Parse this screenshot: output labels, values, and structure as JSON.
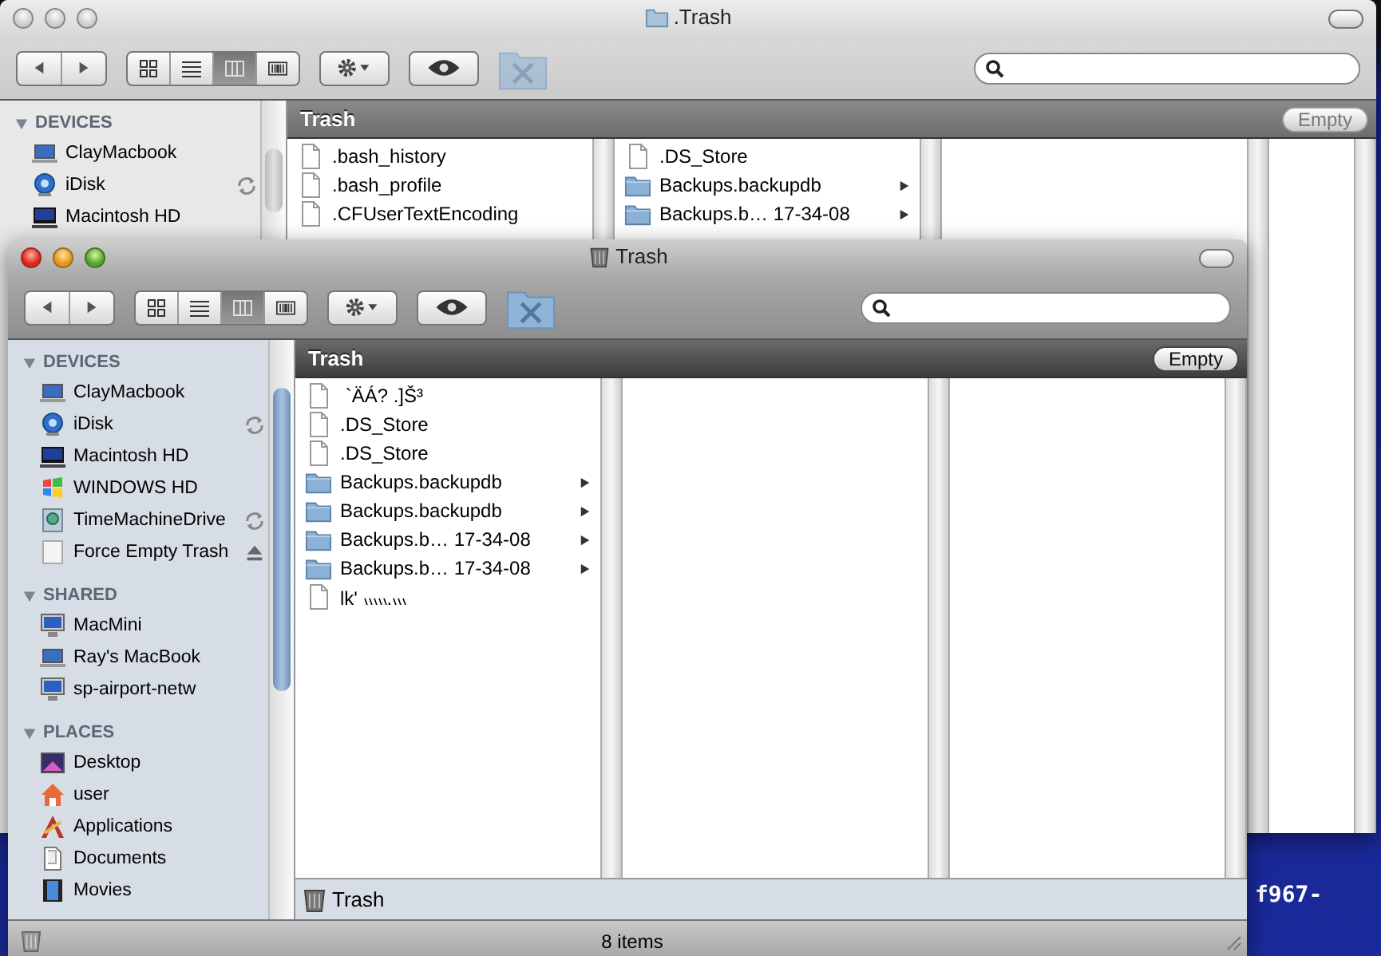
{
  "desktop": {
    "label": "f967-"
  },
  "windows": [
    {
      "active": false,
      "title": ".Trash",
      "kind": "folder",
      "view_modes": [
        {
          "kind": "icons",
          "selected": false
        },
        {
          "kind": "list",
          "selected": false
        },
        {
          "kind": "columns",
          "selected": true
        },
        {
          "kind": "coverflow",
          "selected": false
        }
      ],
      "sidebar": [
        {
          "heading": "DEVICES",
          "expanded": true,
          "items": [
            {
              "label": "ClayMacbook",
              "kind": "laptop"
            },
            {
              "label": "iDisk",
              "kind": "idisk",
              "syncing": true
            },
            {
              "label": "Macintosh HD",
              "kind": "hd"
            }
          ]
        }
      ],
      "path": "Trash",
      "empty_button": "Empty",
      "columns": [
        {
          "items": [
            {
              "label": ".bash_history",
              "kind": "file"
            },
            {
              "label": ".bash_profile",
              "kind": "file"
            },
            {
              "label": ".CFUserTextEncoding",
              "kind": "file"
            }
          ]
        },
        {
          "items": [
            {
              "label": ".DS_Store",
              "kind": "file"
            },
            {
              "label": "Backups.backupdb",
              "kind": "folder"
            },
            {
              "label": "Backups.b… 17-34-08",
              "kind": "folder"
            }
          ]
        },
        {},
        {}
      ]
    },
    {
      "active": true,
      "title": "Trash",
      "kind": "trash",
      "view_modes": [
        {
          "kind": "icons",
          "selected": false
        },
        {
          "kind": "list",
          "selected": false
        },
        {
          "kind": "columns",
          "selected": true
        },
        {
          "kind": "coverflow",
          "selected": false
        }
      ],
      "sidebar": [
        {
          "heading": "DEVICES",
          "expanded": true,
          "items": [
            {
              "label": "ClayMacbook",
              "kind": "laptop"
            },
            {
              "label": "iDisk",
              "kind": "idisk",
              "syncing": true
            },
            {
              "label": "Macintosh HD",
              "kind": "hd"
            },
            {
              "label": "WINDOWS HD",
              "kind": "windows"
            },
            {
              "label": "TimeMachineDrive",
              "kind": "timemachine",
              "syncing": true
            },
            {
              "label": "Force Empty Trash",
              "kind": "drive",
              "ejectable": true
            }
          ]
        },
        {
          "heading": "SHARED",
          "expanded": true,
          "items": [
            {
              "label": "MacMini",
              "kind": "monitor"
            },
            {
              "label": "Ray's MacBook",
              "kind": "laptop"
            },
            {
              "label": "sp-airport-netw",
              "kind": "monitor"
            }
          ]
        },
        {
          "heading": "PLACES",
          "expanded": true,
          "items": [
            {
              "label": "Desktop",
              "kind": "desktop"
            },
            {
              "label": "user",
              "kind": "home"
            },
            {
              "label": "Applications",
              "kind": "apps"
            },
            {
              "label": "Documents",
              "kind": "docs"
            },
            {
              "label": "Movies",
              "kind": "movies"
            }
          ]
        }
      ],
      "path": "Trash",
      "empty_button": "Empty",
      "columns": [
        {
          "items": [
            {
              "label": " `ÄÁ? .]Š³",
              "kind": "file"
            },
            {
              "label": ".DS_Store",
              "kind": "file"
            },
            {
              "label": ".DS_Store",
              "kind": "file"
            },
            {
              "label": "Backups.backupdb",
              "kind": "folder"
            },
            {
              "label": "Backups.backupdb",
              "kind": "folder"
            },
            {
              "label": "Backups.b… 17-34-08",
              "kind": "folder"
            },
            {
              "label": "Backups.b… 17-34-08",
              "kind": "folder"
            },
            {
              "label": "lk' ៶៶៶៶៶.៶៶៶",
              "kind": "file"
            }
          ]
        },
        {},
        {}
      ],
      "footer_path": "Trash",
      "status": "8 items"
    }
  ]
}
